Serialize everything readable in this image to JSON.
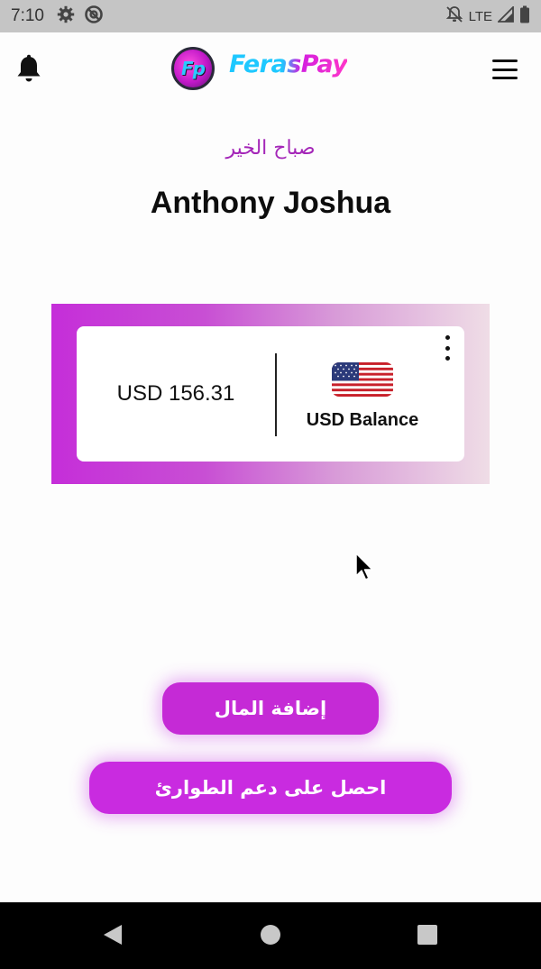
{
  "status_bar": {
    "time": "7:10",
    "network": "LTE"
  },
  "header": {
    "logo_badge": "Fp",
    "app_name": "FerasPay",
    "brand_colors": {
      "cyan": "#1ec8ff",
      "magenta": "#d21fe0"
    }
  },
  "greeting": "صباح الخير",
  "user": {
    "name": "Anthony Joshua"
  },
  "balance_card": {
    "amount": "USD 156.31",
    "label": "USD Balance",
    "flag_icon": "us-flag-icon"
  },
  "actions": {
    "add_money": "إضافة المال",
    "emergency_support": "احصل على دعم الطوارئ"
  },
  "colors": {
    "accent": "#c52ad6",
    "greeting": "#a426b8"
  }
}
